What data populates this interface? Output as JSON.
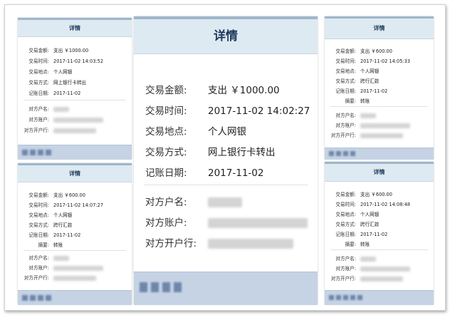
{
  "card": {
    "title": "详情"
  },
  "labels": {
    "amount": "交易金额:",
    "time": "交易时间:",
    "place": "交易地点:",
    "method": "交易方式:",
    "post_date": "记账日期:",
    "memo": "摘要:",
    "payee_name": "对方户名:",
    "payee_account": "对方账户:",
    "payee_bank": "对方开户行:"
  },
  "cards": [
    {
      "amount": "支出 ￥1000.00",
      "time": "2017-11-02 14:03:52",
      "place": "个人网银",
      "method": "网上银行卡转出",
      "post_date": "2017-11-02"
    },
    {
      "amount": "支出 ￥600.00",
      "time": "2017-11-02 14:07:27",
      "place": "个人网银",
      "method": "跨行汇款",
      "post_date": "2017-11-02",
      "memo": "转账"
    },
    {
      "amount": "支出 ￥1000.00",
      "time": "2017-11-02 14:02:27",
      "place": "个人网银",
      "method": "网上银行卡转出",
      "post_date": "2017-11-02"
    },
    {
      "amount": "支出 ￥600.00",
      "time": "2017-11-02 14:05:33",
      "place": "个人网银",
      "method": "跨行汇款",
      "post_date": "2017-11-02",
      "memo": "转账"
    },
    {
      "amount": "支出 ￥600.00",
      "time": "2017-11-02 14:08:48",
      "place": "个人网银",
      "method": "跨行汇款",
      "post_date": "2017-11-02",
      "memo": "转账"
    }
  ]
}
